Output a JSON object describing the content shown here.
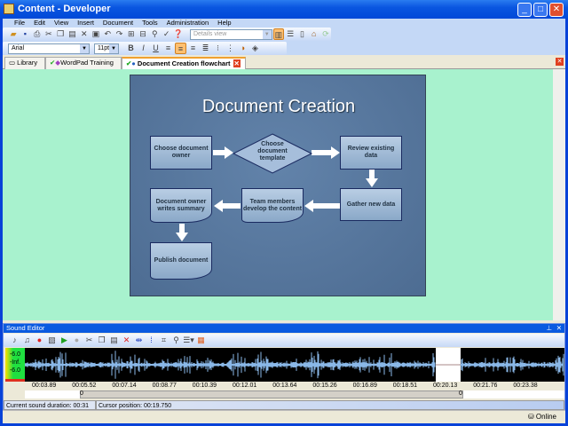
{
  "window": {
    "title": "Content - Developer"
  },
  "menu": [
    "File",
    "Edit",
    "View",
    "Insert",
    "Document",
    "Tools",
    "Administration",
    "Help"
  ],
  "toolbar": {
    "view_combo": "Details view"
  },
  "format": {
    "font": "Arial",
    "size": "11pt",
    "bold": "B",
    "italic": "I",
    "underline": "U"
  },
  "tabs": [
    {
      "label": "Library"
    },
    {
      "label": "WordPad Training"
    },
    {
      "label": "Document Creation flowchart"
    }
  ],
  "slide": {
    "title": "Document Creation",
    "nodes": [
      "Choose document owner",
      "Choose document template",
      "Review existing data",
      "Gather new data",
      "Team members develop the content",
      "Document owner writes summary",
      "Publish document"
    ]
  },
  "sound_editor": {
    "title": "Sound Editor",
    "meter": [
      "-6.0",
      "-Inf.",
      "-6.0"
    ],
    "timeline": [
      "00:03.89",
      "00:05.52",
      "00:07.14",
      "00:08.77",
      "00:10.39",
      "00:12.01",
      "00:13.64",
      "00:15.26",
      "00:16.89",
      "00:18.51",
      "00:20.13",
      "00:21.76",
      "00:23.38"
    ],
    "scroll_start": "0",
    "scroll_end": "0",
    "duration": "Current sound duration: 00:31",
    "cursor": "Cursor position: 00:19.750"
  },
  "statusbar": {
    "online": "Online"
  },
  "colors": {
    "titlebar": "#0a5ae0",
    "content_bg": "#a8f2ce",
    "waveform": "#8ab8e8"
  }
}
